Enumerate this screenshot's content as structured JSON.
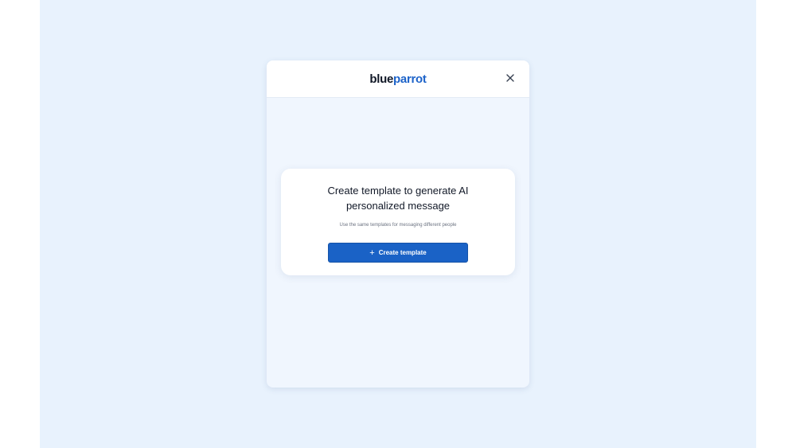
{
  "header": {
    "logo_part_1": "blue",
    "logo_part_2": "parrot",
    "close_glyph": "×"
  },
  "empty_state": {
    "title_line_1": "Create template to generate AI",
    "title_line_2": "personalized message",
    "subtitle": "Use the same templates for messaging different people",
    "button_icon": "+",
    "button_label": "Create template"
  },
  "icons": {
    "close": "close-icon",
    "plus": "plus-icon"
  },
  "colors": {
    "page_background": "#e8f2fd",
    "panel_background": "#f0f6fe",
    "brand_dark": "#111827",
    "brand_blue": "#1d63c9",
    "button_blue": "#1a62c6"
  }
}
